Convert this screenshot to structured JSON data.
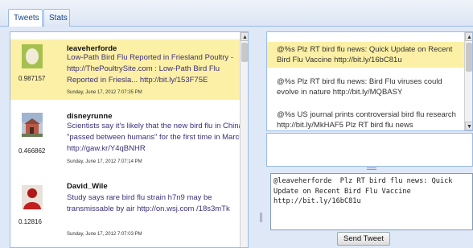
{
  "tabs": [
    {
      "label": "Tweets",
      "active": true
    },
    {
      "label": "Stats",
      "active": false
    }
  ],
  "tweets": [
    {
      "username": "leaveherforde",
      "score": "0.987157",
      "text": "Low-Path Bird Flu Reported in Friesland Poultry - http://ThePoultrySite.com : Low-Path Bird Flu Reported in Friesla... http://bit.ly/153F75E",
      "date": "Sunday, June 17, 2012 7:07:35 PM",
      "avatar_icon": "egg-avatar-icon",
      "selected": true
    },
    {
      "username": "disneyrunne",
      "score": "0.466862",
      "text": "Scientists say it's likely that the new bird flu in China \"passed between humans\" for the first time in March. http://gaw.kr/Y4qBNHR",
      "date": "Sunday, June 17, 2012 7:07:14 PM",
      "avatar_icon": "house-photo-avatar-icon",
      "selected": false
    },
    {
      "username": "David_Wile",
      "score": "0.12816",
      "text": "Study says rare bird flu strain h7n9 may be transmissable by air http://on.wsj.com /18s3mTk",
      "date": "Sunday, June 17, 2012 7:07:03 PM",
      "avatar_icon": "red-person-avatar-icon",
      "selected": false
    }
  ],
  "suggestions": [
    {
      "text": "@%s Plz RT bird flu news: Quick Update on Recent Bird Flu Vaccine http://bit.ly/16bC81u",
      "selected": true
    },
    {
      "text": "@%s Plz RT bird flu news: Bird Flu viruses could evolve in nature http://bit.ly/MQBASY",
      "selected": false
    },
    {
      "text": "@%s US journal prints controversial bird flu research http://bit.ly/MkHAF5 Plz RT bird flu news",
      "selected": false
    }
  ],
  "compose": {
    "value": "@leaveherforde  Plz RT bird flu news: Quick Update on Recent Bird Flu Vaccine http://bit.ly/16bC81u"
  },
  "send_button": {
    "label": "Send Tweet"
  },
  "colors": {
    "selection": "#fbf0a6",
    "panel_border": "#99bbe8",
    "tab_text": "#15428b",
    "tweet_text": "#3d2f7a"
  }
}
